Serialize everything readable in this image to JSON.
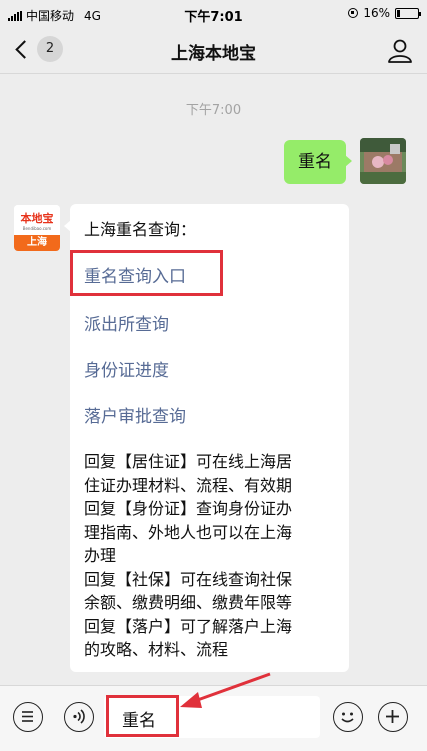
{
  "status_bar": {
    "carrier": "中国移动",
    "network": "4G",
    "time": "下午7:01",
    "battery": "16%",
    "battery_level": 0.16,
    "signal_icon": "signal-bars-icon",
    "rotation_lock_icon": "rotation-lock-icon"
  },
  "nav": {
    "title": "上海本地宝",
    "unread_count": "2",
    "back_icon": "chevron-left-icon",
    "profile_icon": "user-icon"
  },
  "chat": {
    "timestamp": "下午7:00",
    "user_message": "重名",
    "bot_avatar": {
      "logo_text": "本地宝",
      "logo_url": "Bendibao.com",
      "city": "上海"
    },
    "bot_message": {
      "heading": "上海重名查询：",
      "links": [
        "重名查询入口",
        "派出所查询",
        "身份证进度",
        "落户审批查询"
      ],
      "body_lines": [
        "回复【居住证】可在线上海居",
        "住证办理材料、流程、有效期",
        "回复【身份证】查询身份证办",
        "理指南、外地人也可以在上海",
        "办理",
        "回复【社保】可在线查询社保",
        "余额、缴费明细、缴费年限等",
        "回复【落户】可了解落户上海",
        "的攻略、材料、流程"
      ]
    }
  },
  "input_bar": {
    "text": "重名",
    "menu_icon": "menu-list-icon",
    "voice_icon": "voice-icon",
    "emoji_icon": "emoji-icon",
    "plus_icon": "plus-icon"
  },
  "colors": {
    "background": "#ededed",
    "user_bubble": "#95ec69",
    "link": "#576b95",
    "highlight": "#e0313b"
  }
}
